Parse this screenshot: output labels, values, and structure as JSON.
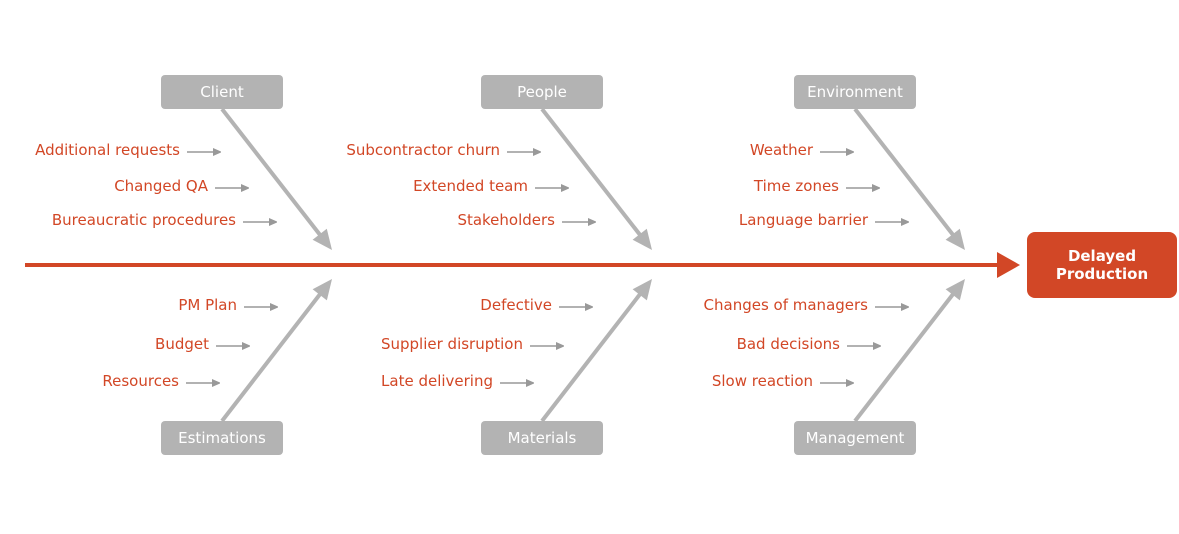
{
  "effect": "Delayed Production",
  "colors": {
    "accent": "#d24726",
    "branch": "#b3b3b3",
    "small_arrow": "#999999"
  },
  "categories": [
    {
      "name": "Client",
      "position": "top",
      "causes": [
        "Additional requests",
        "Changed QA",
        "Bureaucratic procedures"
      ]
    },
    {
      "name": "People",
      "position": "top",
      "causes": [
        "Subcontractor churn",
        "Extended team",
        "Stakeholders"
      ]
    },
    {
      "name": "Environment",
      "position": "top",
      "causes": [
        "Weather",
        "Time zones",
        "Language barrier"
      ]
    },
    {
      "name": "Estimations",
      "position": "bottom",
      "causes": [
        "PM Plan",
        "Budget",
        "Resources"
      ]
    },
    {
      "name": "Materials",
      "position": "bottom",
      "causes": [
        "Defective",
        "Supplier disruption",
        "Late delivering"
      ]
    },
    {
      "name": "Management",
      "position": "bottom",
      "causes": [
        "Changes of managers",
        "Bad decisions",
        "Slow reaction"
      ]
    }
  ]
}
